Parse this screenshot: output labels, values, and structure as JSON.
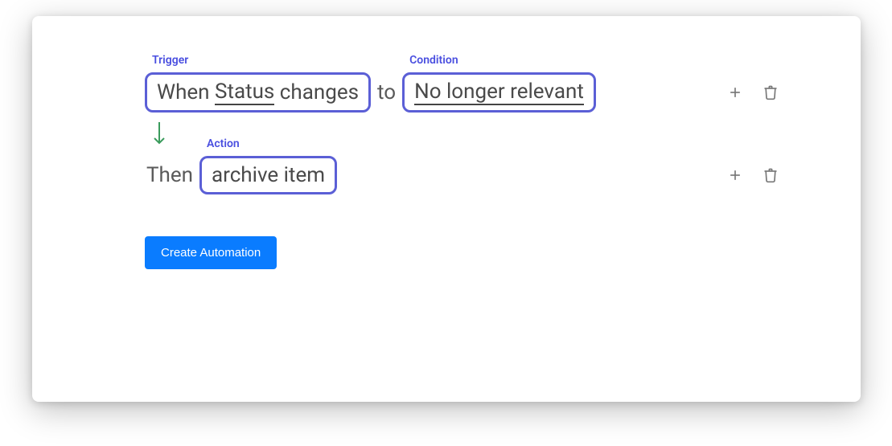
{
  "labels": {
    "trigger": "Trigger",
    "condition": "Condition",
    "action": "Action"
  },
  "trigger": {
    "prefix": "When",
    "field": "Status",
    "verb": "changes"
  },
  "connector": {
    "to": "to",
    "then": "Then"
  },
  "condition": {
    "value": "No longer relevant"
  },
  "action": {
    "value": "archive item"
  },
  "button": {
    "create": "Create Automation"
  }
}
